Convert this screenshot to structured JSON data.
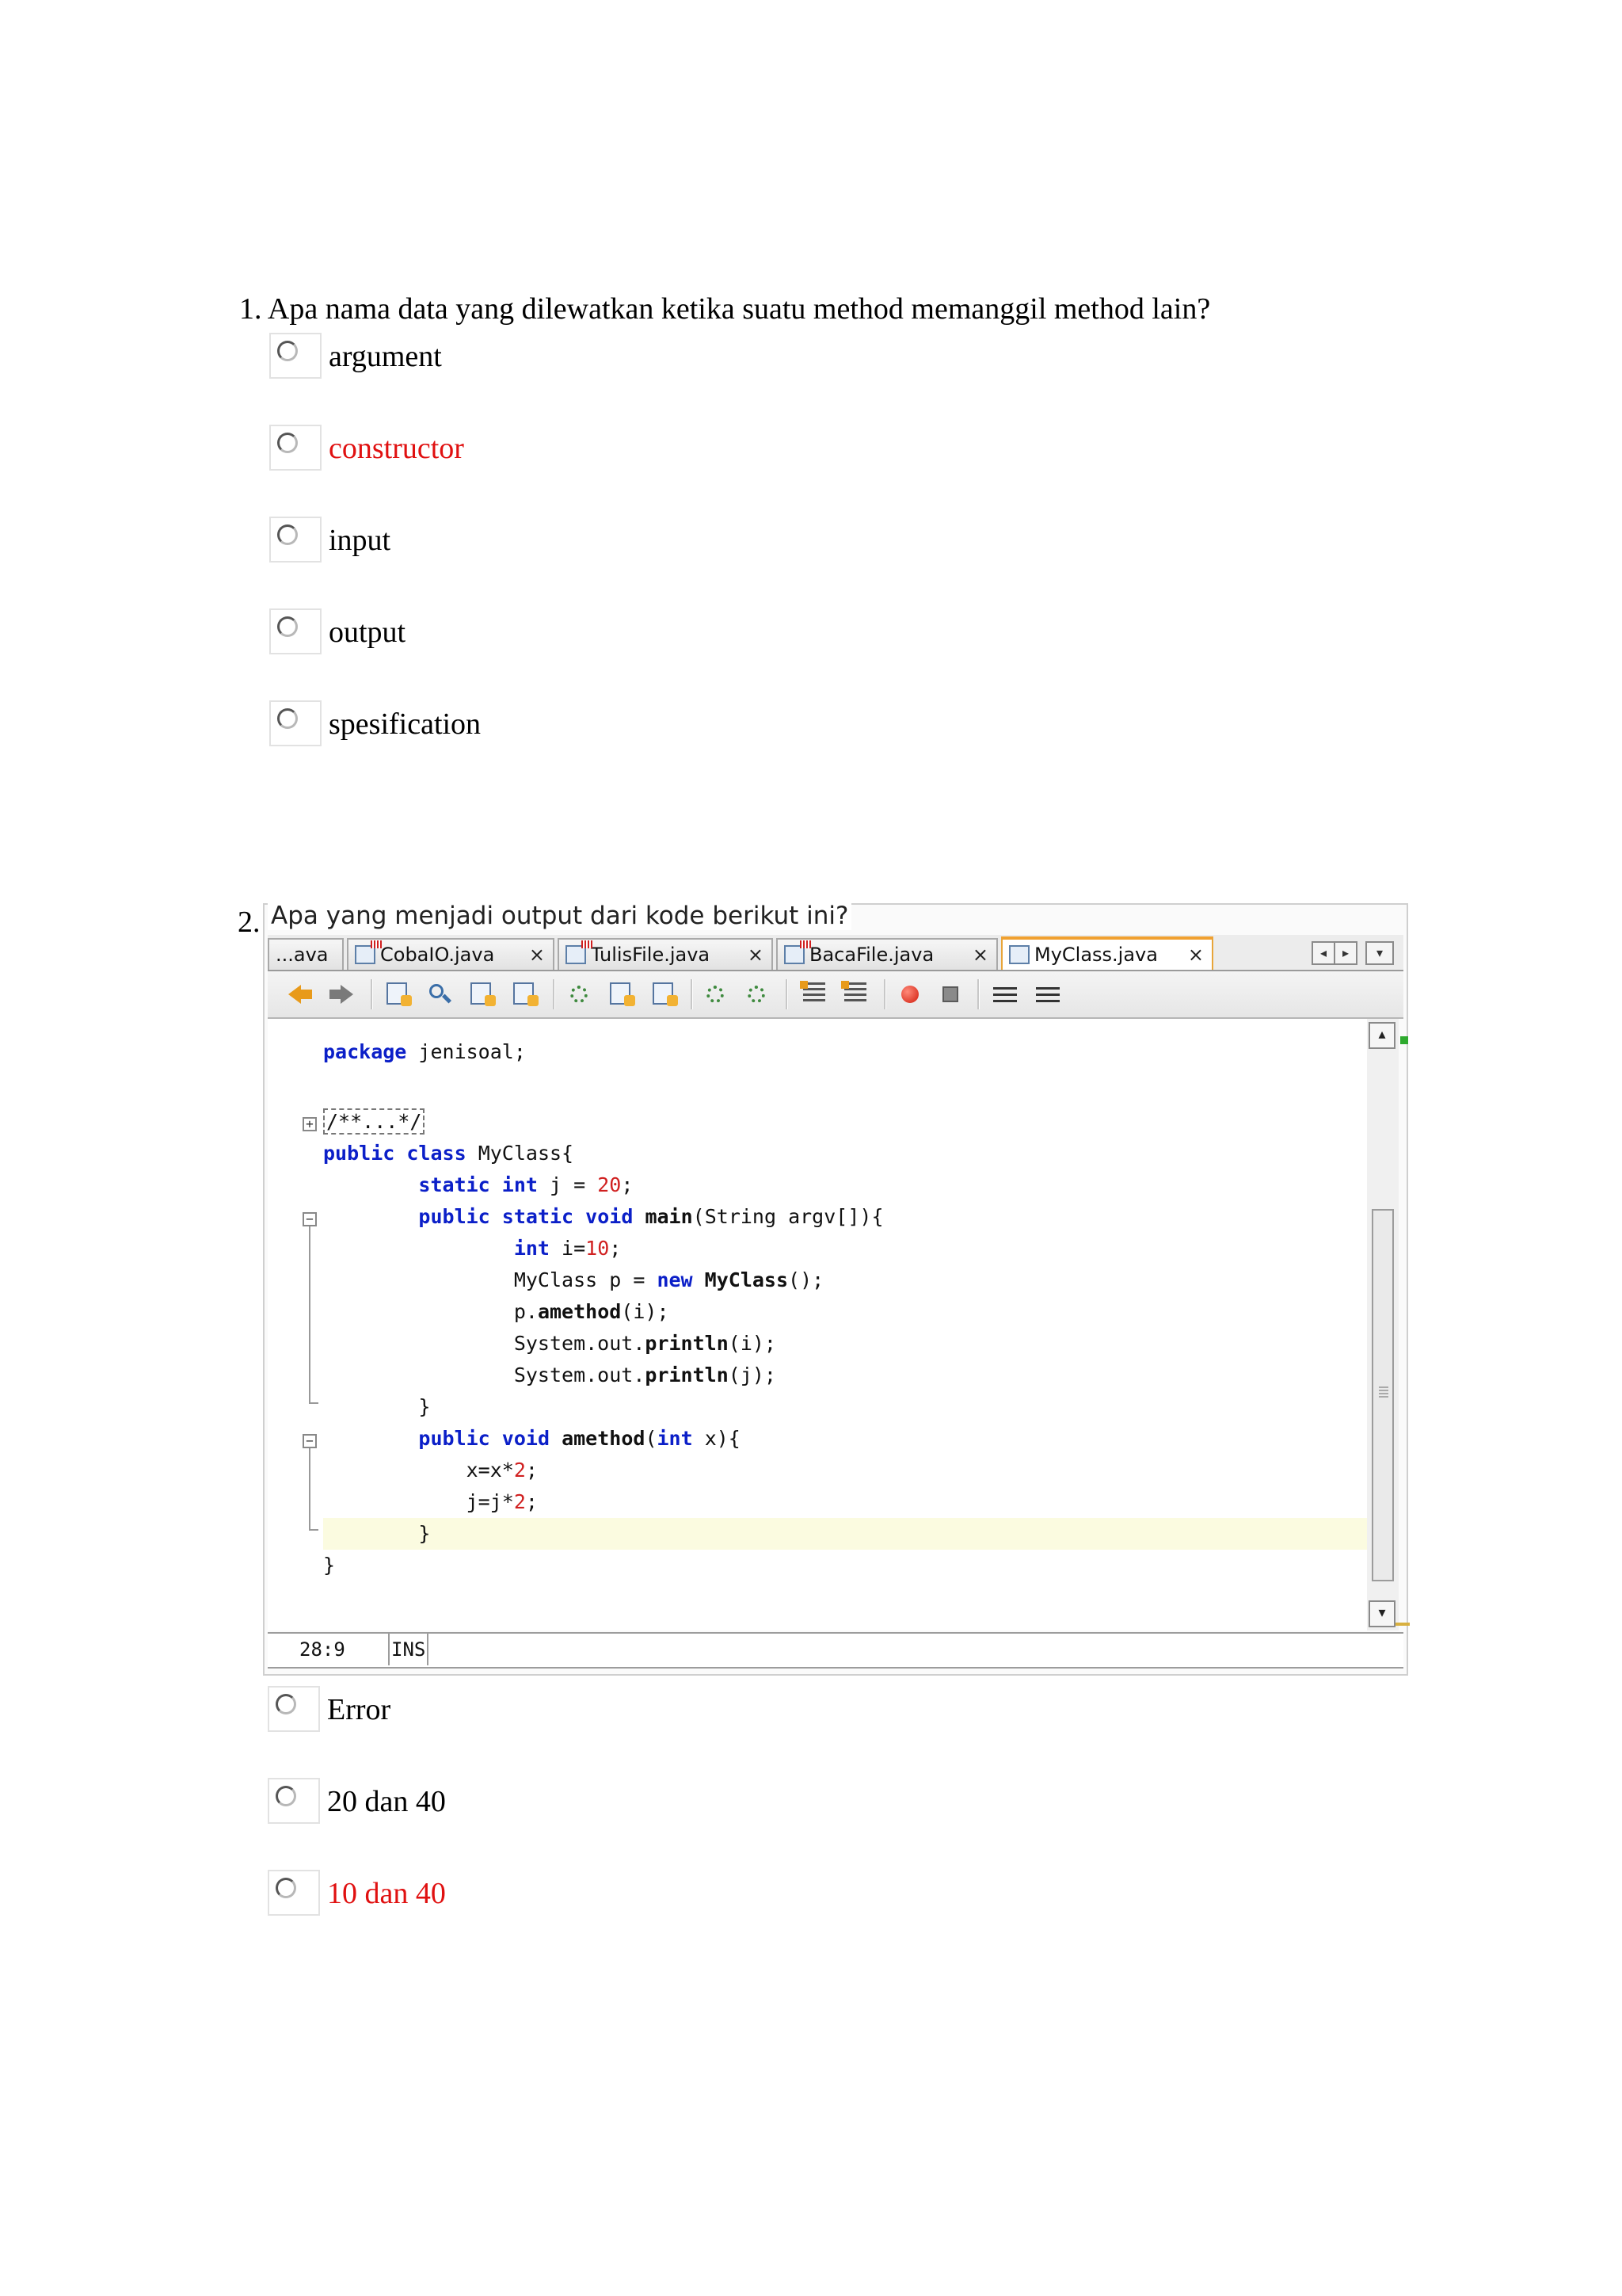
{
  "questions": [
    {
      "number": "1.",
      "text": "Apa nama data yang dilewatkan ketika suatu method memanggil method lain?",
      "options": [
        {
          "label": "argument",
          "color": "#000000"
        },
        {
          "label": "constructor",
          "color": "#e01010"
        },
        {
          "label": "input",
          "color": "#000000"
        },
        {
          "label": "output",
          "color": "#000000"
        },
        {
          "label": "spesification",
          "color": "#000000"
        }
      ]
    },
    {
      "number": "2.",
      "text": "Apa yang menjadi output dari kode berikut ini?",
      "options": [
        {
          "label": "Error",
          "color": "#000000"
        },
        {
          "label": "20 dan 40",
          "color": "#000000"
        },
        {
          "label": "10 dan 40",
          "color": "#e01010"
        }
      ]
    }
  ],
  "ide": {
    "tabs": [
      {
        "label": "...ava",
        "active": false
      },
      {
        "label": "CobaIO.java",
        "active": false,
        "close": "×"
      },
      {
        "label": "TulisFile.java",
        "active": false,
        "close": "×"
      },
      {
        "label": "BacaFile.java",
        "active": false,
        "close": "×"
      },
      {
        "label": "MyClass.java",
        "active": true,
        "close": "×"
      }
    ],
    "nav_left": "◂",
    "nav_right": "▸",
    "nav_menu": "▾",
    "toolbar_icons": [
      "back-arrow-icon",
      "forward-arrow-icon",
      "find-previous-icon",
      "find-icon",
      "find-next-icon",
      "toggle-highlight-icon",
      "shift-left-icon",
      "shift-right-icon",
      "comment-icon",
      "uncomment-icon",
      "format-icon",
      "reformat-icon",
      "record-macro-icon",
      "stop-macro-icon",
      "bookmark-icon",
      "toggle-bookmark-icon"
    ],
    "code": {
      "line1": "jenisoal;",
      "kw_package": "package",
      "comment": "/**...*/",
      "kw_public": "public",
      "kw_class": "class",
      "class_name": "MyClass{",
      "kw_static": "static",
      "kw_int": "int",
      "j_decl": "j = ",
      "num_20": "20",
      "semi": ";",
      "kw_void": "void",
      "main_name": "main",
      "main_args": "(String argv[]){",
      "i_decl": "i=",
      "num_10": "10",
      "p_decl": "MyClass p = ",
      "kw_new": "new",
      "new_class": "MyClass",
      "new_paren": "();",
      "p_prefix": "p.",
      "amethod": "amethod",
      "amethod_call_args": "(i);",
      "sysout": "System.out.",
      "println": "println",
      "println_i": "(i);",
      "println_j": "(j);",
      "close_brace": "}",
      "amethod_open": "(",
      "amethod_param": " x){",
      "x_assign": "x=x*",
      "j_assign": "j=j*",
      "num_2": "2"
    },
    "status": {
      "position": "28:9",
      "mode": "INS"
    },
    "scroll_up": "▴",
    "scroll_down": "▾"
  }
}
